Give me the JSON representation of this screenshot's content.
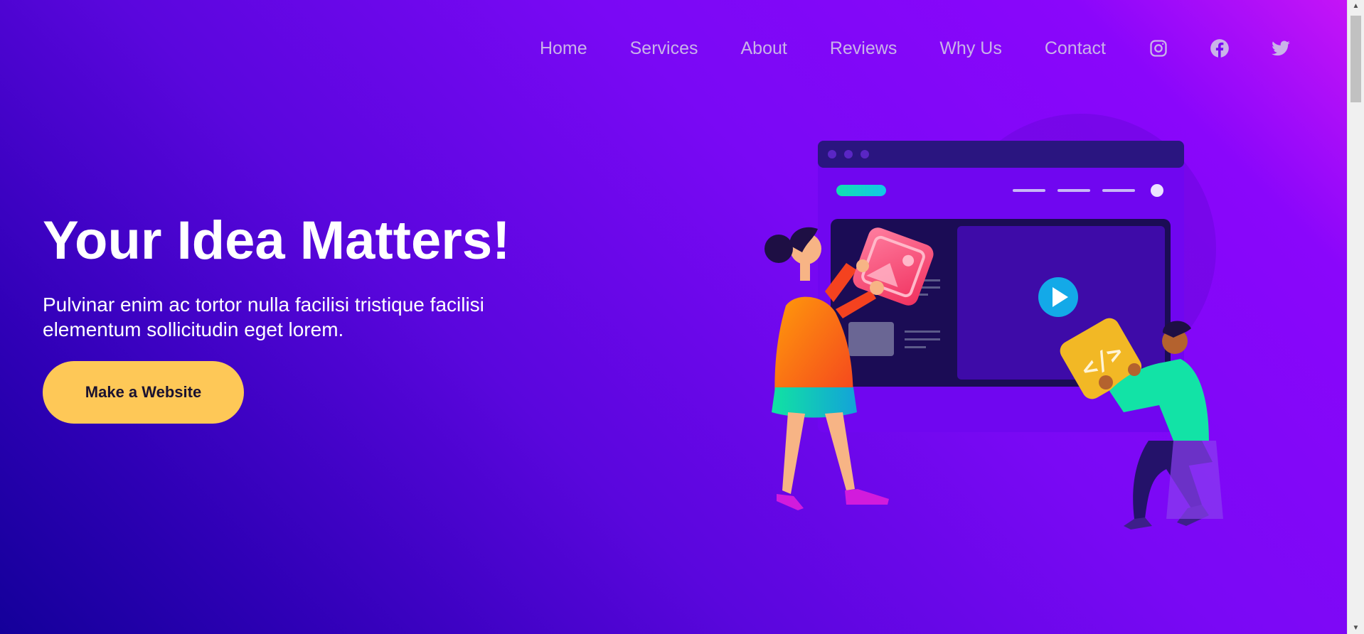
{
  "nav": {
    "items": [
      "Home",
      "Services",
      "About",
      "Reviews",
      "Why Us",
      "Contact"
    ],
    "social": [
      "instagram-icon",
      "facebook-icon",
      "twitter-icon"
    ]
  },
  "hero": {
    "title": "Your Idea Matters!",
    "subtitle": "Pulvinar enim ac tortor nulla facilisi tristique facilisi elementum sollicitudin eget lorem.",
    "cta_label": "Make a Website"
  },
  "colors": {
    "gradient_start": "#c514f7",
    "gradient_mid": "#7a08f5",
    "gradient_end": "#14009a",
    "nav_text": "#c9b3e8",
    "cta_bg": "#fec857"
  }
}
